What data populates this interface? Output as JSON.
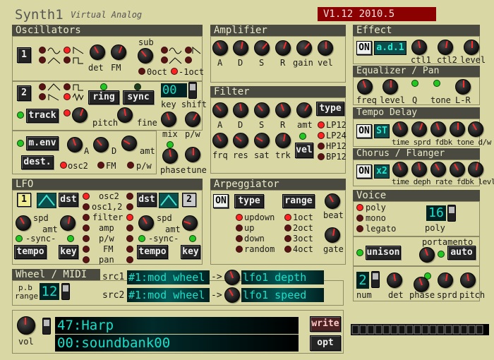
{
  "title": "Synth1",
  "subtitle": "Virtual Analog",
  "version": "V1.12 2010.5",
  "osc": {
    "header": "Oscillators",
    "osc1": "1",
    "det": "det",
    "fm": "FM",
    "sub": "sub",
    "oct0": "0oct",
    "octm1": "-1oct",
    "osc2": "2",
    "ring": "ring",
    "sync": "sync",
    "track": "track",
    "pitch": "pitch",
    "fine": "fine",
    "key_shift": "00",
    "key_shift_lbl": "key shift",
    "mix": "mix",
    "pw": "p/w",
    "menv": "m.env",
    "dest": "dest.",
    "a": "A",
    "d": "D",
    "amt": "amt",
    "d_osc2": "osc2",
    "d_fm": "FM",
    "d_pw": "p/w",
    "phase": "phase",
    "tune": "tune"
  },
  "amp": {
    "header": "Amplifier",
    "labels": [
      "A",
      "D",
      "S",
      "R",
      "gain",
      "vel"
    ]
  },
  "filter": {
    "header": "Filter",
    "labels": [
      "A",
      "D",
      "S",
      "R",
      "amt"
    ],
    "type": "type",
    "labels2": [
      "frq",
      "res",
      "sat",
      "trk"
    ],
    "vel": "vel",
    "types": [
      "LP12",
      "LP24",
      "HP12",
      "BP12"
    ]
  },
  "lfo": {
    "header": "LFO",
    "n1": "1",
    "n2": "2",
    "dst": "dst",
    "spd": "spd",
    "amt": "amt",
    "sync": "-sync-",
    "tempo": "tempo",
    "key": "key",
    "dests": [
      "osc2",
      "osc1,2",
      "filter",
      "amp",
      "p/w",
      "FM",
      "pan"
    ]
  },
  "arp": {
    "header": "Arpeggiator",
    "on": "ON",
    "type": "type",
    "range": "range",
    "types": [
      "updown",
      "up",
      "down",
      "random"
    ],
    "ranges": [
      "1oct",
      "2oct",
      "3oct",
      "4oct"
    ],
    "beat": "beat",
    "gate": "gate"
  },
  "effect": {
    "header": "Effect",
    "on": "ON",
    "mode": "a.d.1",
    "ctl1": "ctl1",
    "ctl2": "ctl2",
    "level": "level"
  },
  "eq": {
    "header": "Equalizer / Pan",
    "labels": [
      "freq",
      "level",
      "Q",
      "tone",
      "L-R"
    ]
  },
  "tempo_delay": {
    "header": "Tempo Delay",
    "on": "ON",
    "mode": "ST",
    "labels": "time sprd fdbk tone d/w"
  },
  "chorus": {
    "header": "Chorus / Flanger",
    "on": "ON",
    "mode": "x2",
    "labels": "time deph rate fdbk levl"
  },
  "voice": {
    "header": "Voice",
    "modes": [
      "poly",
      "mono",
      "legato"
    ],
    "poly_count": "16",
    "poly": "poly",
    "portamento": "portamento",
    "auto": "auto",
    "unison": "unison",
    "num": "2",
    "num_lbl": "num",
    "det": "det",
    "phase": "phase",
    "sprd": "sprd",
    "pitch": "pitch"
  },
  "wheel": {
    "header": "Wheel / MIDI",
    "pb": "p.b",
    "range": "range",
    "range_val": "12",
    "src1": "src1",
    "src2": "src2",
    "src1_val": "#1:mod wheel",
    "src2_val": "#1:mod wheel",
    "arrow": "->",
    "dst1": "lfo1 depth",
    "dst2": "lfo1 speed"
  },
  "patch": {
    "vol": "vol",
    "name": "47:Harp",
    "bank": "00:soundbank00",
    "write": "write",
    "opt": "opt"
  }
}
